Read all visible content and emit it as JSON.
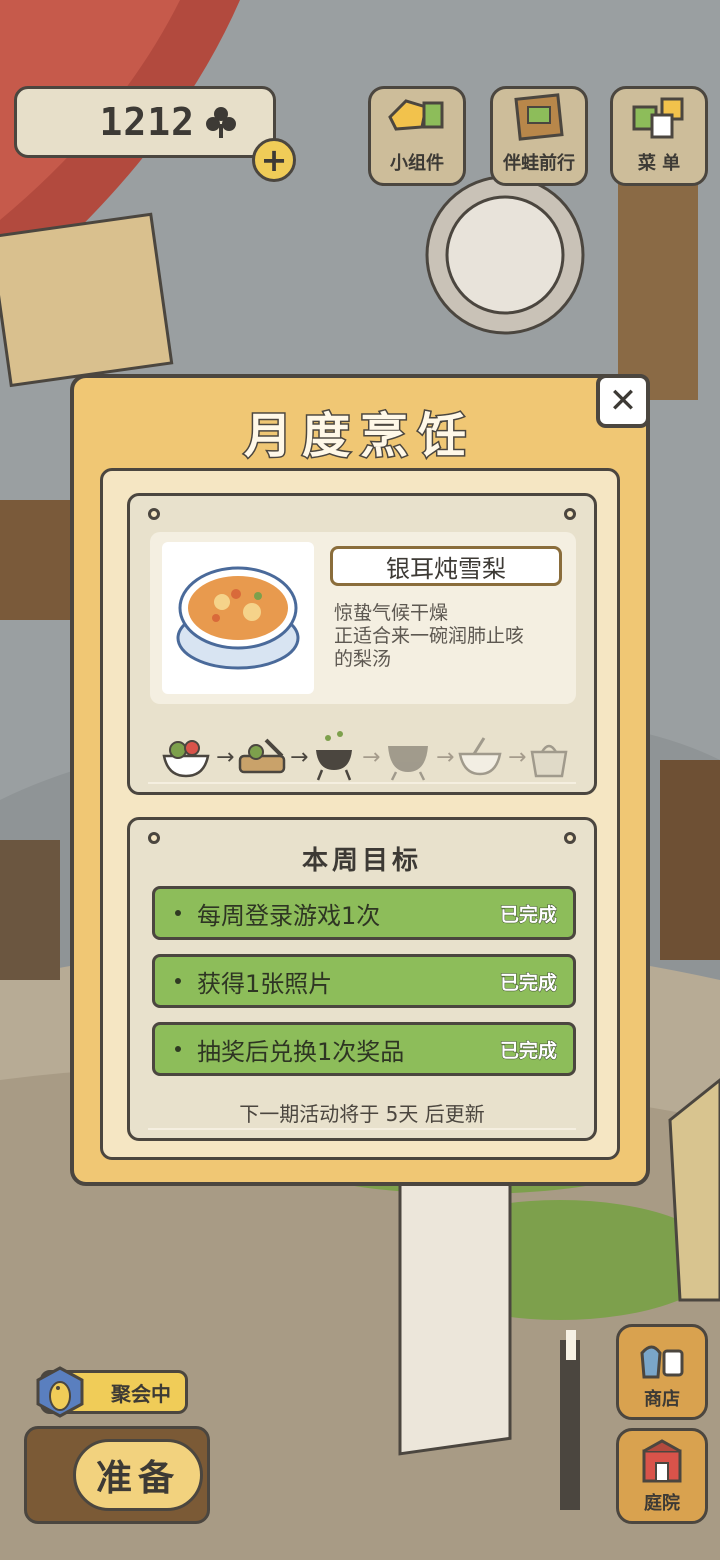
{
  "currency": {
    "value": "1212",
    "icon": "clover-icon",
    "add_label": "+"
  },
  "top_menu": [
    {
      "label": "小组件",
      "icon": "widget-icon"
    },
    {
      "label": "伴蛙前行",
      "icon": "journal-icon"
    },
    {
      "label": "菜 单",
      "icon": "menu-icon"
    }
  ],
  "dialog": {
    "title": "月度烹饪",
    "close_label": "✕",
    "recipe": {
      "name": "银耳炖雪梨",
      "description": [
        "惊蛰气候干燥",
        "正适合来一碗润肺止咳",
        "的梨汤"
      ],
      "image": "pear-soup-icon",
      "steps": [
        "ingredients-bowl-icon",
        "chopping-board-icon",
        "cooking-pot-icon",
        "stewing-pot-icon",
        "serving-bowl-icon",
        "bag-icon"
      ],
      "steps_completed": 3
    },
    "weekly_goals": {
      "title": "本周目标",
      "items": [
        {
          "text": "每周登录游戏1次",
          "status": "已完成"
        },
        {
          "text": "获得1张照片",
          "status": "已完成"
        },
        {
          "text": "抽奖后兑换1次奖品",
          "status": "已完成"
        }
      ],
      "footer": "下一期活动将于 5天 后更新"
    }
  },
  "bottom_left": {
    "party_label": "聚会中",
    "ready_label": "准备"
  },
  "side_buttons": [
    {
      "label": "商店",
      "icon": "shop-icon"
    },
    {
      "label": "庭院",
      "icon": "garden-icon"
    }
  ],
  "colors": {
    "panel": "#f0c774",
    "goal_green": "#8dbd5a",
    "outline": "#4b463f",
    "card": "#e8e1cc"
  }
}
